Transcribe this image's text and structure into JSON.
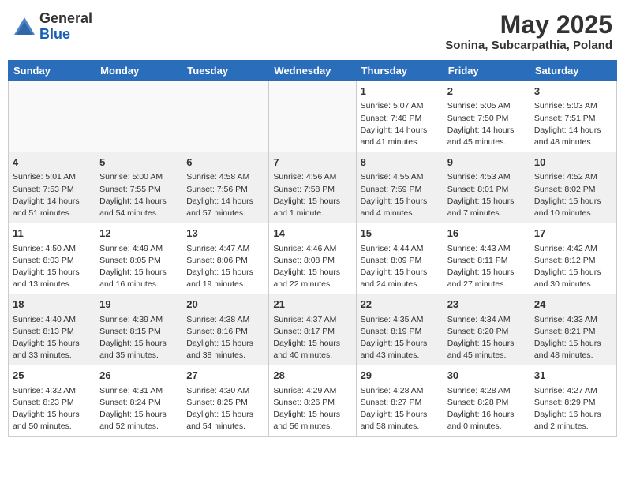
{
  "header": {
    "logo_general": "General",
    "logo_blue": "Blue",
    "month_title": "May 2025",
    "subtitle": "Sonina, Subcarpathia, Poland"
  },
  "weekdays": [
    "Sunday",
    "Monday",
    "Tuesday",
    "Wednesday",
    "Thursday",
    "Friday",
    "Saturday"
  ],
  "weeks": [
    [
      {
        "num": "",
        "info": ""
      },
      {
        "num": "",
        "info": ""
      },
      {
        "num": "",
        "info": ""
      },
      {
        "num": "",
        "info": ""
      },
      {
        "num": "1",
        "info": "Sunrise: 5:07 AM\nSunset: 7:48 PM\nDaylight: 14 hours\nand 41 minutes."
      },
      {
        "num": "2",
        "info": "Sunrise: 5:05 AM\nSunset: 7:50 PM\nDaylight: 14 hours\nand 45 minutes."
      },
      {
        "num": "3",
        "info": "Sunrise: 5:03 AM\nSunset: 7:51 PM\nDaylight: 14 hours\nand 48 minutes."
      }
    ],
    [
      {
        "num": "4",
        "info": "Sunrise: 5:01 AM\nSunset: 7:53 PM\nDaylight: 14 hours\nand 51 minutes."
      },
      {
        "num": "5",
        "info": "Sunrise: 5:00 AM\nSunset: 7:55 PM\nDaylight: 14 hours\nand 54 minutes."
      },
      {
        "num": "6",
        "info": "Sunrise: 4:58 AM\nSunset: 7:56 PM\nDaylight: 14 hours\nand 57 minutes."
      },
      {
        "num": "7",
        "info": "Sunrise: 4:56 AM\nSunset: 7:58 PM\nDaylight: 15 hours\nand 1 minute."
      },
      {
        "num": "8",
        "info": "Sunrise: 4:55 AM\nSunset: 7:59 PM\nDaylight: 15 hours\nand 4 minutes."
      },
      {
        "num": "9",
        "info": "Sunrise: 4:53 AM\nSunset: 8:01 PM\nDaylight: 15 hours\nand 7 minutes."
      },
      {
        "num": "10",
        "info": "Sunrise: 4:52 AM\nSunset: 8:02 PM\nDaylight: 15 hours\nand 10 minutes."
      }
    ],
    [
      {
        "num": "11",
        "info": "Sunrise: 4:50 AM\nSunset: 8:03 PM\nDaylight: 15 hours\nand 13 minutes."
      },
      {
        "num": "12",
        "info": "Sunrise: 4:49 AM\nSunset: 8:05 PM\nDaylight: 15 hours\nand 16 minutes."
      },
      {
        "num": "13",
        "info": "Sunrise: 4:47 AM\nSunset: 8:06 PM\nDaylight: 15 hours\nand 19 minutes."
      },
      {
        "num": "14",
        "info": "Sunrise: 4:46 AM\nSunset: 8:08 PM\nDaylight: 15 hours\nand 22 minutes."
      },
      {
        "num": "15",
        "info": "Sunrise: 4:44 AM\nSunset: 8:09 PM\nDaylight: 15 hours\nand 24 minutes."
      },
      {
        "num": "16",
        "info": "Sunrise: 4:43 AM\nSunset: 8:11 PM\nDaylight: 15 hours\nand 27 minutes."
      },
      {
        "num": "17",
        "info": "Sunrise: 4:42 AM\nSunset: 8:12 PM\nDaylight: 15 hours\nand 30 minutes."
      }
    ],
    [
      {
        "num": "18",
        "info": "Sunrise: 4:40 AM\nSunset: 8:13 PM\nDaylight: 15 hours\nand 33 minutes."
      },
      {
        "num": "19",
        "info": "Sunrise: 4:39 AM\nSunset: 8:15 PM\nDaylight: 15 hours\nand 35 minutes."
      },
      {
        "num": "20",
        "info": "Sunrise: 4:38 AM\nSunset: 8:16 PM\nDaylight: 15 hours\nand 38 minutes."
      },
      {
        "num": "21",
        "info": "Sunrise: 4:37 AM\nSunset: 8:17 PM\nDaylight: 15 hours\nand 40 minutes."
      },
      {
        "num": "22",
        "info": "Sunrise: 4:35 AM\nSunset: 8:19 PM\nDaylight: 15 hours\nand 43 minutes."
      },
      {
        "num": "23",
        "info": "Sunrise: 4:34 AM\nSunset: 8:20 PM\nDaylight: 15 hours\nand 45 minutes."
      },
      {
        "num": "24",
        "info": "Sunrise: 4:33 AM\nSunset: 8:21 PM\nDaylight: 15 hours\nand 48 minutes."
      }
    ],
    [
      {
        "num": "25",
        "info": "Sunrise: 4:32 AM\nSunset: 8:23 PM\nDaylight: 15 hours\nand 50 minutes."
      },
      {
        "num": "26",
        "info": "Sunrise: 4:31 AM\nSunset: 8:24 PM\nDaylight: 15 hours\nand 52 minutes."
      },
      {
        "num": "27",
        "info": "Sunrise: 4:30 AM\nSunset: 8:25 PM\nDaylight: 15 hours\nand 54 minutes."
      },
      {
        "num": "28",
        "info": "Sunrise: 4:29 AM\nSunset: 8:26 PM\nDaylight: 15 hours\nand 56 minutes."
      },
      {
        "num": "29",
        "info": "Sunrise: 4:28 AM\nSunset: 8:27 PM\nDaylight: 15 hours\nand 58 minutes."
      },
      {
        "num": "30",
        "info": "Sunrise: 4:28 AM\nSunset: 8:28 PM\nDaylight: 16 hours\nand 0 minutes."
      },
      {
        "num": "31",
        "info": "Sunrise: 4:27 AM\nSunset: 8:29 PM\nDaylight: 16 hours\nand 2 minutes."
      }
    ]
  ]
}
